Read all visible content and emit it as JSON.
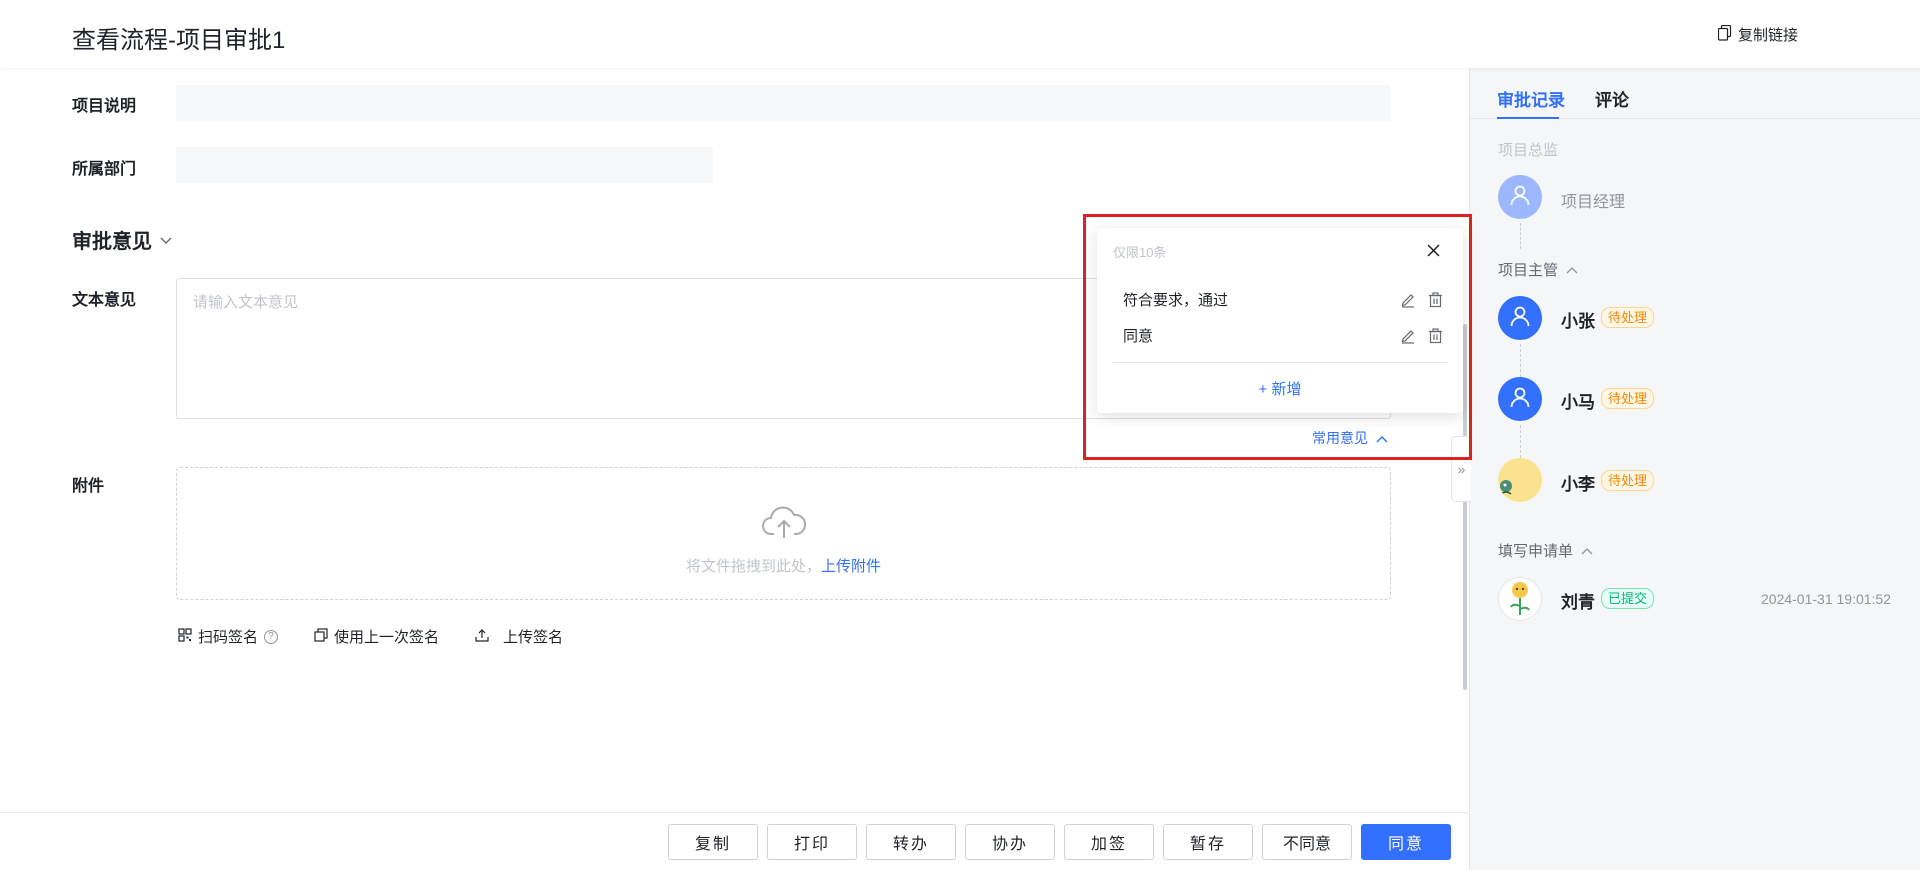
{
  "header": {
    "title": "查看流程-项目审批1",
    "copy_link_label": "复制链接"
  },
  "form": {
    "project_desc_label": "项目说明",
    "department_label": "所属部门",
    "approval_section_title": "审批意见",
    "text_opinion_label": "文本意见",
    "text_opinion_placeholder": "请输入文本意见",
    "common_opinion_label": "常用意见",
    "attachment_label": "附件",
    "upload_hint": "将文件拖拽到此处，",
    "upload_link": "上传附件",
    "sign_tools": {
      "scan_sign": "扫码签名",
      "use_last_sign": "使用上一次签名",
      "upload_sign": "上传签名"
    }
  },
  "popover": {
    "limit_text": "仅限10条",
    "opinions": [
      "符合要求，通过",
      "同意"
    ],
    "add_label": "+ 新增"
  },
  "footer": {
    "buttons": [
      "复制",
      "打印",
      "转办",
      "协办",
      "加签",
      "暂存",
      "不同意",
      "同意"
    ]
  },
  "right_panel": {
    "tabs": [
      "审批记录",
      "评论"
    ],
    "nodes": [
      {
        "title": "项目总监",
        "person": "项目经理"
      },
      {
        "title": "项目主管",
        "people": [
          {
            "name": "小张",
            "status": "待处理"
          },
          {
            "name": "小马",
            "status": "待处理"
          },
          {
            "name": "小李",
            "status": "待处理"
          }
        ]
      },
      {
        "title": "填写申请单",
        "people": [
          {
            "name": "刘青",
            "status": "已提交",
            "time": "2024-01-31 19:01:52"
          }
        ]
      }
    ]
  },
  "colors": {
    "primary": "#3370ff",
    "pending": "#ff8800",
    "done": "#00b578",
    "highlight": "#e02020"
  }
}
